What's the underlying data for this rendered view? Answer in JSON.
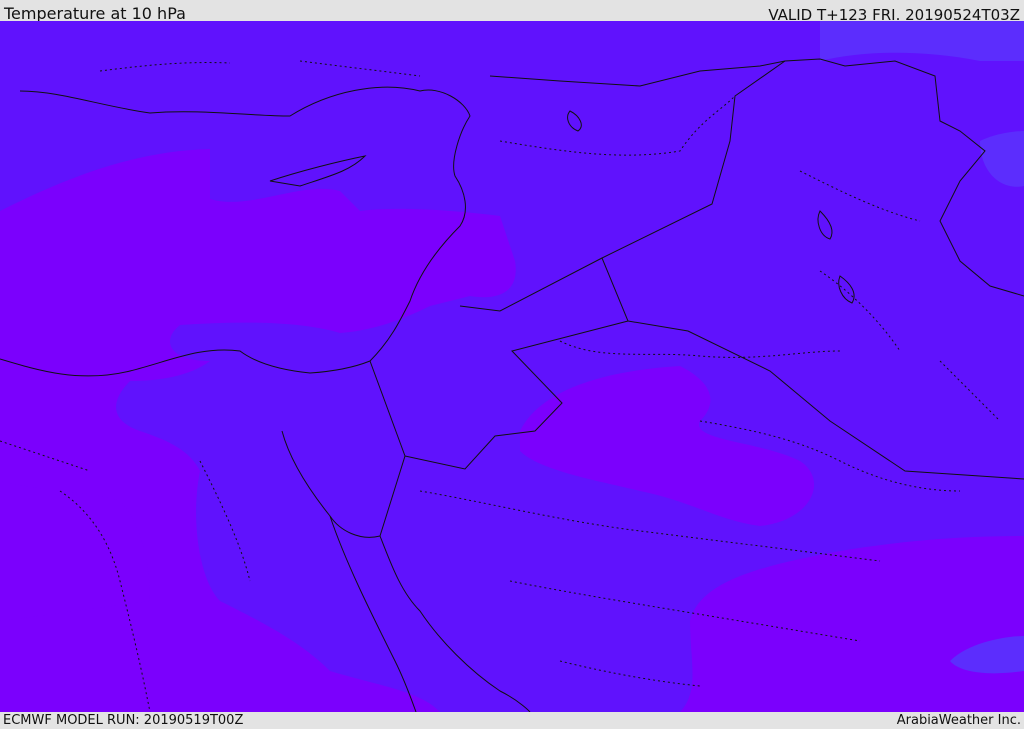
{
  "header": {
    "title": "Temperature at 10 hPa",
    "valid": "VALID T+123 FRI. 20190524T03Z"
  },
  "footer": {
    "model_run": "ECMWF MODEL RUN: 20190519T00Z",
    "credit": "ArabiaWeather Inc."
  },
  "map": {
    "colors": {
      "base_fill": "#6012fd",
      "warm_fill": "#7b00fd",
      "cool_fill": "#5c2dfd",
      "boundary": "#111111"
    }
  }
}
